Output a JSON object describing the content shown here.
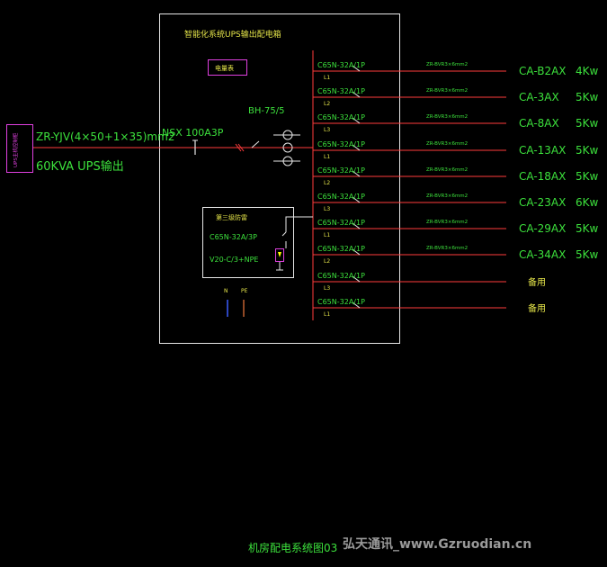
{
  "panel_title": "智能化系统UPS输出配电箱",
  "meter_label": "电量表",
  "ups_label": "UPS主机控制柜",
  "input_cable": "ZR-YJV(4×50+1×35)mm2",
  "ups_output": "60KVA UPS输出",
  "main_switch": "NSX 100A3P",
  "meter_model": "BH-75/5",
  "spd_title": "第三级防雷",
  "spd_breaker": "C65N-32A/3P",
  "spd_model": "V20-C/3+NPE",
  "n_label": "N",
  "pe_label": "PE",
  "circuits": [
    {
      "breaker": "C65N-32A/1P",
      "phase": "L1",
      "cable": "ZR-BVR3×6mm2",
      "load": "CA-B2AX",
      "power": "4Kw"
    },
    {
      "breaker": "C65N-32A/1P",
      "phase": "L2",
      "cable": "ZR-BVR3×6mm2",
      "load": "CA-3AX",
      "power": "5Kw"
    },
    {
      "breaker": "C65N-32A/1P",
      "phase": "L3",
      "cable": "ZR-BVR3×6mm2",
      "load": "CA-8AX",
      "power": "5Kw"
    },
    {
      "breaker": "C65N-32A/1P",
      "phase": "L1",
      "cable": "ZR-BVR3×6mm2",
      "load": "CA-13AX",
      "power": "5Kw"
    },
    {
      "breaker": "C65N-32A/1P",
      "phase": "L2",
      "cable": "ZR-BVR3×6mm2",
      "load": "CA-18AX",
      "power": "5Kw"
    },
    {
      "breaker": "C65N-32A/1P",
      "phase": "L3",
      "cable": "ZR-BVR3×6mm2",
      "load": "CA-23AX",
      "power": "6Kw"
    },
    {
      "breaker": "C65N-32A/1P",
      "phase": "L1",
      "cable": "ZR-BVR3×6mm2",
      "load": "CA-29AX",
      "power": "5Kw"
    },
    {
      "breaker": "C65N-32A/1P",
      "phase": "L2",
      "cable": "ZR-BVR3×6mm2",
      "load": "CA-34AX",
      "power": "5Kw"
    },
    {
      "breaker": "C65N-32A/1P",
      "phase": "L3",
      "cable": "",
      "load": "备用",
      "power": ""
    },
    {
      "breaker": "C65N-32A/1P",
      "phase": "L1",
      "cable": "",
      "load": "备用",
      "power": ""
    }
  ],
  "drawing_title": "机房配电系统图03",
  "watermark": "弘天通讯_www.Gzruodian.cn"
}
